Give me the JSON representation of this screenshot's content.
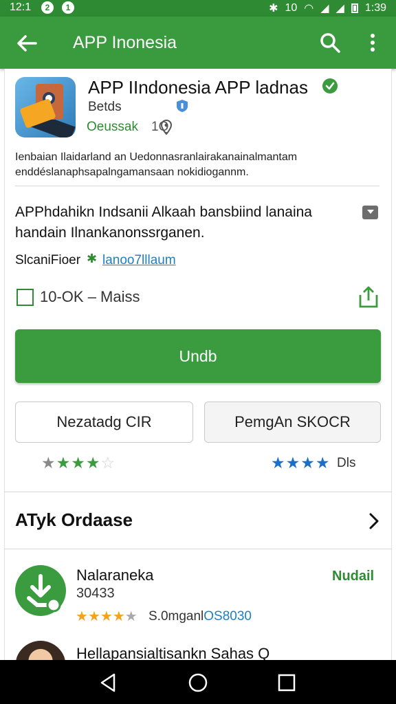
{
  "status_bar": {
    "time_left": "12:1",
    "notifications": [
      "2",
      "1"
    ],
    "signal_text": "10",
    "time_right": "1:39"
  },
  "app_bar": {
    "title": "APP Inonesia"
  },
  "app": {
    "name": "APP IIndonesia APP ladnas",
    "developer": "Betds",
    "rating_label": "Oeussak",
    "rating_value": "1Q",
    "description": "Ienbaian Ilaidarland an Uedonnasranlairakanainalmantam enddéslanaphsapalngamansaan nokidiogannm.",
    "tagline": "APPhdahikn Indsanii Alkaah bansbiind lanaina handain Ilnankanonssrganen.",
    "similar_label": "SlcaniFioer",
    "similar_link": "lanoo7lllaum",
    "downloads": "10-OK – Maiss",
    "install_label": "Undb",
    "secondary_left": "Nezatadg CIR",
    "secondary_right": "PemgAn SKOCR",
    "ratings_right_label": "Dls"
  },
  "related": {
    "section_title": "ATyk Ordaase",
    "items": [
      {
        "name": "Nalaraneka",
        "subtitle": "30433",
        "rating_text": "S.0mganl",
        "rating_code": "OS8030",
        "action": "Nudail"
      },
      {
        "name": "Hellapansialtisankn Sahas Q"
      }
    ]
  },
  "colors": {
    "primary": "#3a9c3f",
    "status_bar": "#2e8a33",
    "link": "#1e7fc2",
    "star_yellow": "#f2a31b",
    "star_blue": "#1c6fc9"
  },
  "icons": [
    "back-arrow-icon",
    "search-icon",
    "more-vert-icon",
    "verified-badge-icon",
    "pin-icon",
    "share-icon",
    "chevron-right-icon",
    "back-nav-icon",
    "home-nav-icon",
    "recents-nav-icon"
  ]
}
